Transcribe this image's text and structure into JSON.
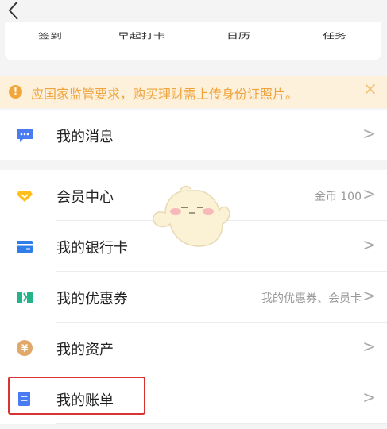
{
  "header": {
    "back_icon": "chevron-left-icon"
  },
  "quick_actions": [
    {
      "label": "签到"
    },
    {
      "label": "早起打卡"
    },
    {
      "label": "日历"
    },
    {
      "label": "任务"
    }
  ],
  "notice": {
    "icon": "exclamation-circle-icon",
    "text": "应国家监管要求，购买理财需上传身份证照片。",
    "close_icon": "close-icon",
    "color": "#f0a33b",
    "background": "#fdf1dc"
  },
  "menu_group_1": [
    {
      "label": "我的消息",
      "icon": "message-icon",
      "icon_color": "#4a7bf0"
    }
  ],
  "menu_group_2": [
    {
      "label": "会员中心",
      "extra": "金币 100",
      "icon": "diamond-icon",
      "icon_color": "#ffbe1a"
    },
    {
      "label": "我的银行卡",
      "extra": "",
      "icon": "bank-card-icon",
      "icon_color": "#2f7ee8"
    },
    {
      "label": "我的优惠券",
      "extra": "我的优惠券、会员卡",
      "icon": "coupon-icon",
      "icon_color": "#25b38a"
    },
    {
      "label": "我的资产",
      "extra": "",
      "icon": "yen-coin-icon",
      "icon_color": "#e0a96a"
    },
    {
      "label": "我的账单",
      "extra": "",
      "icon": "bill-icon",
      "icon_color": "#4a7bf0"
    }
  ],
  "chevron": ">",
  "highlight_color": "#d93232"
}
